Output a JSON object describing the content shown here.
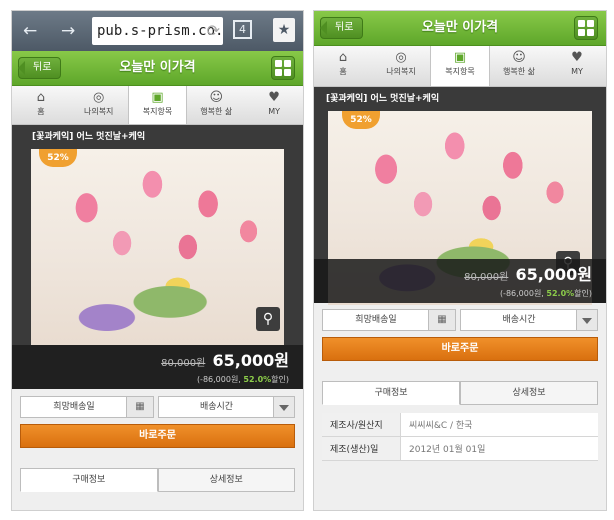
{
  "browser": {
    "url": "pub.s-prism.co.k",
    "tab_count": "4",
    "back_glyph": "←",
    "forward_glyph": "→",
    "reload_glyph": "⟳",
    "bookmark_glyph": "★"
  },
  "header": {
    "back_label": "뒤로",
    "title": "오늘만 이가격"
  },
  "nav": [
    {
      "label": "홈",
      "icon": "home-icon",
      "glyph": "⌂"
    },
    {
      "label": "나의복지",
      "icon": "coins-icon",
      "glyph": "◎"
    },
    {
      "label": "복지항목",
      "icon": "gift-icon",
      "glyph": "▣",
      "active": true
    },
    {
      "label": "행복한 삶",
      "icon": "people-icon",
      "glyph": "☺"
    },
    {
      "label": "MY",
      "icon": "heart-book-icon",
      "glyph": "♥"
    }
  ],
  "product": {
    "title": "[꽃과케익] 어느 멋진날+케익",
    "discount_badge": "52%",
    "original_price": "80,000원",
    "sale_price": "65,000원",
    "savings_prefix": "(-86,000원, ",
    "savings_pct": "52.0%",
    "savings_suffix": "할인)",
    "zoom_glyph": "⚲"
  },
  "order": {
    "date_placeholder": "희망배송일",
    "calendar_glyph": "▦",
    "time_placeholder": "배송시간",
    "buy_label": "바로주문"
  },
  "info": {
    "tab_purchase": "구매정보",
    "tab_detail": "상세정보",
    "rows": [
      {
        "label": "제조사/원산지",
        "value": "씨씨씨&C / 한국"
      },
      {
        "label": "제조(생산)일",
        "value": "2012년 01월 01일"
      }
    ]
  },
  "colors": {
    "accent_green": "#5ea72a",
    "buy_orange": "#e07a1a",
    "discount_green": "#8ccc4a",
    "badge_orange": "#f0a030"
  }
}
